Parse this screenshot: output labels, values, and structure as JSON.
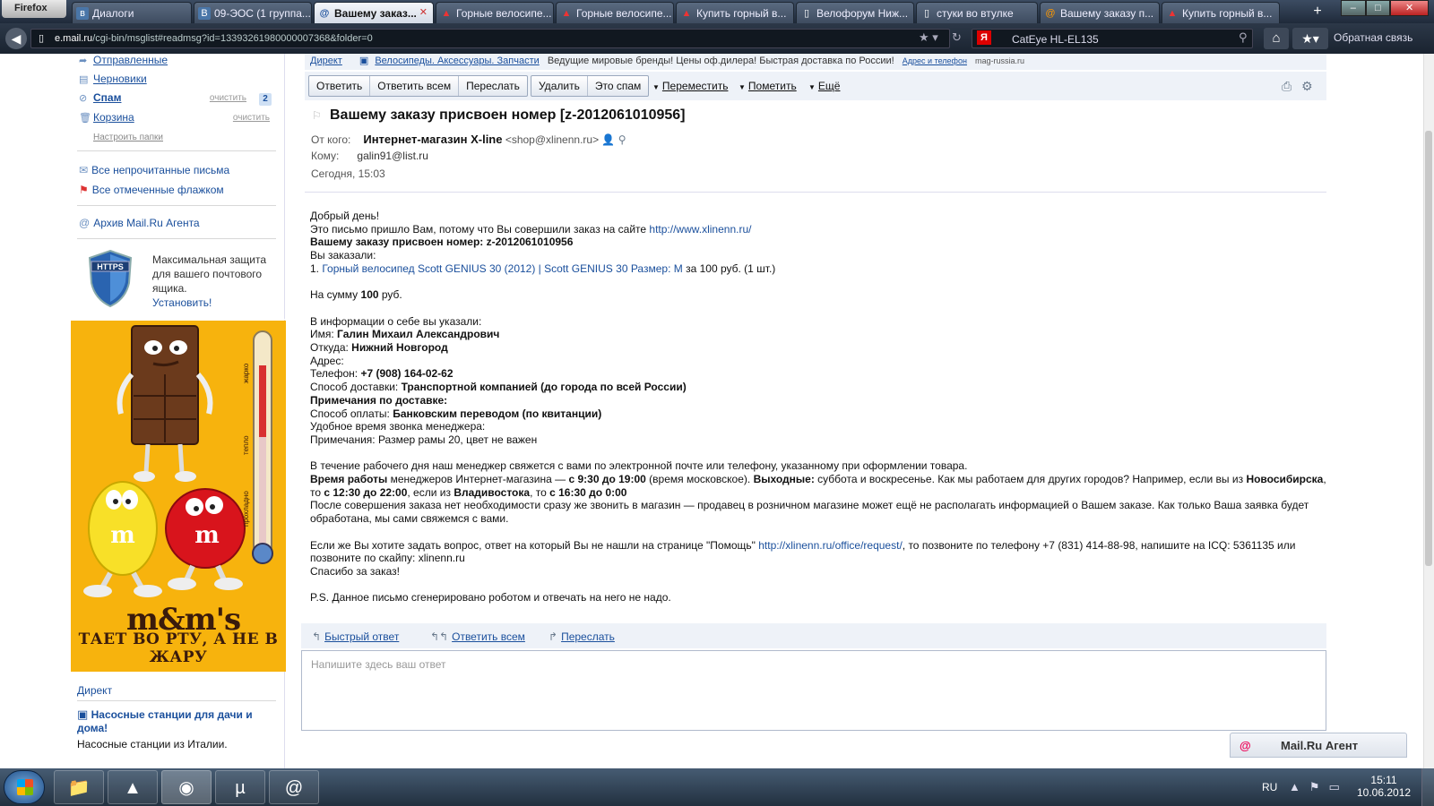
{
  "browser": {
    "menu_label": "Firefox",
    "tabs": [
      {
        "label": "Диалоги",
        "icon": "vk"
      },
      {
        "label": "09-ЭОС (1 группа...",
        "icon": "vk"
      },
      {
        "label": "Вашему заказ...",
        "icon": "mailru",
        "active": true
      },
      {
        "label": "Горные велосипе...",
        "icon": "shop-red"
      },
      {
        "label": "Горные велосипе...",
        "icon": "shop-red"
      },
      {
        "label": "Купить горный в...",
        "icon": "shop-red"
      },
      {
        "label": "Велофорум Ниж...",
        "icon": "page"
      },
      {
        "label": "стуки во втулке",
        "icon": "page"
      },
      {
        "label": "Вашему заказу п...",
        "icon": "mailru"
      },
      {
        "label": "Купить горный в...",
        "icon": "shop-red"
      }
    ],
    "new_tab": "+",
    "url_domain": "e.mail.ru",
    "url_path": "/cgi-bin/msglist#readmsg?id=13393261980000007368&folder=0",
    "search_value": "CatEye HL-EL135",
    "feedback_label": "Обратная связь"
  },
  "sidebar": {
    "folders": [
      {
        "label": "Отправленные",
        "icon": "sent-icon"
      },
      {
        "label": "Черновики",
        "icon": "drafts-icon"
      },
      {
        "label": "Спам",
        "icon": "spam-icon",
        "clean": "очистить",
        "count": "2"
      },
      {
        "label": "Корзина",
        "icon": "trash-icon",
        "clean": "очистить"
      }
    ],
    "configure_folders": "Настроить папки",
    "unread_link": "Все непрочитанные письма",
    "flagged_link": "Все отмеченные флажком",
    "agent_archive": "Архив Mail.Ru Агента",
    "https_text": "Максимальная защита для вашего почтового ящика.",
    "https_install": "Установить!",
    "https_badge": "HTTPS",
    "ad_logo": "m&m's",
    "ad_slogan": "ТАЕТ ВО РТУ, А НЕ В ЖАРУ",
    "ad_thermo_labels": [
      "жарко",
      "тепло",
      "прохладно"
    ],
    "direct_label": "Директ",
    "ad2_title": "Насосные станции для дачи и дома!",
    "ad2_text": "Насосные станции из Италии."
  },
  "mail": {
    "topstrip": {
      "direct": "Директ",
      "ad_title": "Велосипеды. Аксессуары. Запчасти",
      "ad_desc": "Ведущие мировые бренды! Цены оф.дилера! Быстрая доставка по России!",
      "ad_contacts": "Адрес и телефон",
      "ad_site": "mag-russia.ru"
    },
    "toolbar": {
      "group1": [
        "Ответить",
        "Ответить всем",
        "Переслать"
      ],
      "group2": [
        "Удалить",
        "Это спам"
      ],
      "move": "Переместить",
      "mark": "Пометить",
      "more": "Ещё"
    },
    "subject": "Вашему заказу присвоен номер [z-2012061010956]",
    "from_label": "От кого:",
    "from_name": "Интернет-магазин X-line",
    "from_email": "<shop@xlinenn.ru>",
    "to_label": "Кому:",
    "to_value": "galin91@list.ru",
    "date": "Сегодня, 15:03",
    "body": {
      "greeting": "Добрый день!",
      "intro": "Это письмо пришло Вам, потому что Вы совершили заказ на сайте ",
      "intro_link": "http://www.xlinenn.ru/",
      "order_number": "Вашему заказу присвоен номер: z-2012061010956",
      "ordered": "Вы заказали:",
      "item_num": "1. ",
      "item_link": "Горный велосипед Scott GENIUS 30 (2012) | Scott GENIUS 30 Размер: M",
      "item_price": " за 100 руб. (1 шт.)",
      "sum_prefix": "На сумму ",
      "sum_value": "100",
      "sum_suffix": " руб.",
      "info_title": "В информации о себе вы указали:",
      "name_label": "Имя: ",
      "name_value": "Галин Михаил Александрович",
      "from_city_label": "Откуда: ",
      "from_city_value": "Нижний Новгород",
      "address_label": "Адрес:",
      "phone_label": "Телефон: ",
      "phone_value": "+7 (908) 164-02-62",
      "delivery_label": "Способ доставки: ",
      "delivery_value": "Транспортной компанией (до города по всей России)",
      "delivery_notes": "Примечания по доставке:",
      "payment_label": "Способ оплаты: ",
      "payment_value": "Банковским переводом (по квитанции)",
      "call_time": "Удобное время звонка менеджера:",
      "notes": "Примечания: Размер рамы 20, цвет не важен",
      "manager": "В течение рабочего дня наш менеджер свяжется с вами по электронной почте или телефону, указанному при оформлении товара.",
      "hours_label": "Время работы",
      "hours_text1": " менеджеров Интернет-магазина — ",
      "hours_value": "с 9:30 до 19:00",
      "hours_text2": " (время московское). ",
      "weekend_label": "Выходные:",
      "weekend_text": " суббота и воскресенье. Как мы работаем для других городов? Например, если вы из ",
      "city1": "Новосибирска",
      "city1_text": ", то ",
      "city1_hours": "с 12:30 до 22:00",
      "city2_pre": ", если из ",
      "city2": "Владивостока",
      "city2_text": ", то ",
      "city2_hours": "с 16:30 до 0:00",
      "after_order": "После совершения заказа нет необходимости сразу же звонить в магазин — продавец в розничном магазине может ещё не располагать информацией о Вашем заказе. Как только Ваша заявка будет обработана, мы сами свяжемся с вами.",
      "question_pre": "Если же Вы хотите задать вопрос, ответ на который Вы не нашли на странице \"Помощь\" ",
      "question_link": "http://xlinenn.ru/office/request/",
      "question_post": ", то позвоните по телефону +7 (831) 414-88-98, напишите на ICQ: 5361135 или позвоните по скайпу: xlinenn.ru",
      "thanks": "Спасибо за заказ!",
      "ps": "P.S. Данное письмо сгенерировано роботом и отвечать на него не надо."
    },
    "reply": {
      "quick": "Быстрый ответ",
      "all": "Ответить всем",
      "forward": "Переслать",
      "placeholder": "Напишите здесь ваш ответ"
    },
    "agent_label": "Mail.Ru Агент"
  },
  "taskbar": {
    "lang": "RU",
    "time": "15:11",
    "date": "10.06.2012"
  },
  "colors": {
    "link": "#1a4f9c",
    "tabbar": "#2c3848",
    "toolbar_bg": "#eef2f8",
    "ad_yellow": "#f7b30d"
  }
}
